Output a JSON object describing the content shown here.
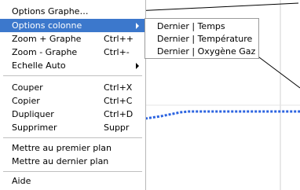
{
  "menu": {
    "items": [
      {
        "label": "Options Graphe…",
        "shortcut": ""
      },
      {
        "label": "Options colonne",
        "shortcut": "",
        "has_submenu": true,
        "selected": true
      },
      {
        "label": "Zoom + Graphe",
        "shortcut": "Ctrl++"
      },
      {
        "label": "Zoom - Graphe",
        "shortcut": "Ctrl+-"
      },
      {
        "label": "Echelle Auto",
        "shortcut": "",
        "has_submenu": true
      },
      {
        "label": "Couper",
        "shortcut": "Ctrl+X"
      },
      {
        "label": "Copier",
        "shortcut": "Ctrl+C"
      },
      {
        "label": "Dupliquer",
        "shortcut": "Ctrl+D"
      },
      {
        "label": "Supprimer",
        "shortcut": "Suppr"
      },
      {
        "label": "Mettre au premier plan",
        "shortcut": ""
      },
      {
        "label": "Mettre au dernier plan",
        "shortcut": ""
      },
      {
        "label": "Aide",
        "shortcut": ""
      }
    ]
  },
  "submenu": {
    "items": [
      {
        "label": "Dernier | Temps"
      },
      {
        "label": "Dernier | Température"
      },
      {
        "label": "Dernier | Oxygène Gaz"
      }
    ]
  },
  "colors": {
    "selection": "#3c78cc",
    "series": "#2b63e0",
    "gridline": "#d0d0d0"
  }
}
